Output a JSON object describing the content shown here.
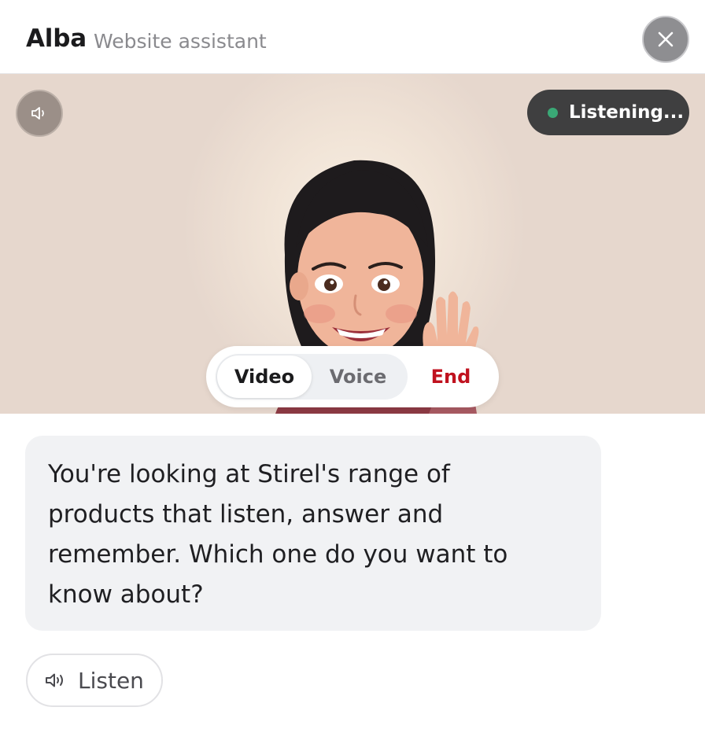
{
  "header": {
    "name": "Alba",
    "role": "Website assistant",
    "close_icon": "close-icon"
  },
  "stage": {
    "mute_icon": "speaker-icon",
    "status": "Listening...",
    "status_color": "#3aa876",
    "avatar": "waving-woman-avatar"
  },
  "mode_switch": {
    "video": "Video",
    "voice": "Voice",
    "end": "End",
    "selected": "Video",
    "end_color": "#c0121f"
  },
  "message": {
    "text": "You're looking at Stirel's range of products that listen, answer and remember. Which one do you want to know about?"
  },
  "listen_button": {
    "label": "Listen",
    "icon": "speaker-icon"
  }
}
